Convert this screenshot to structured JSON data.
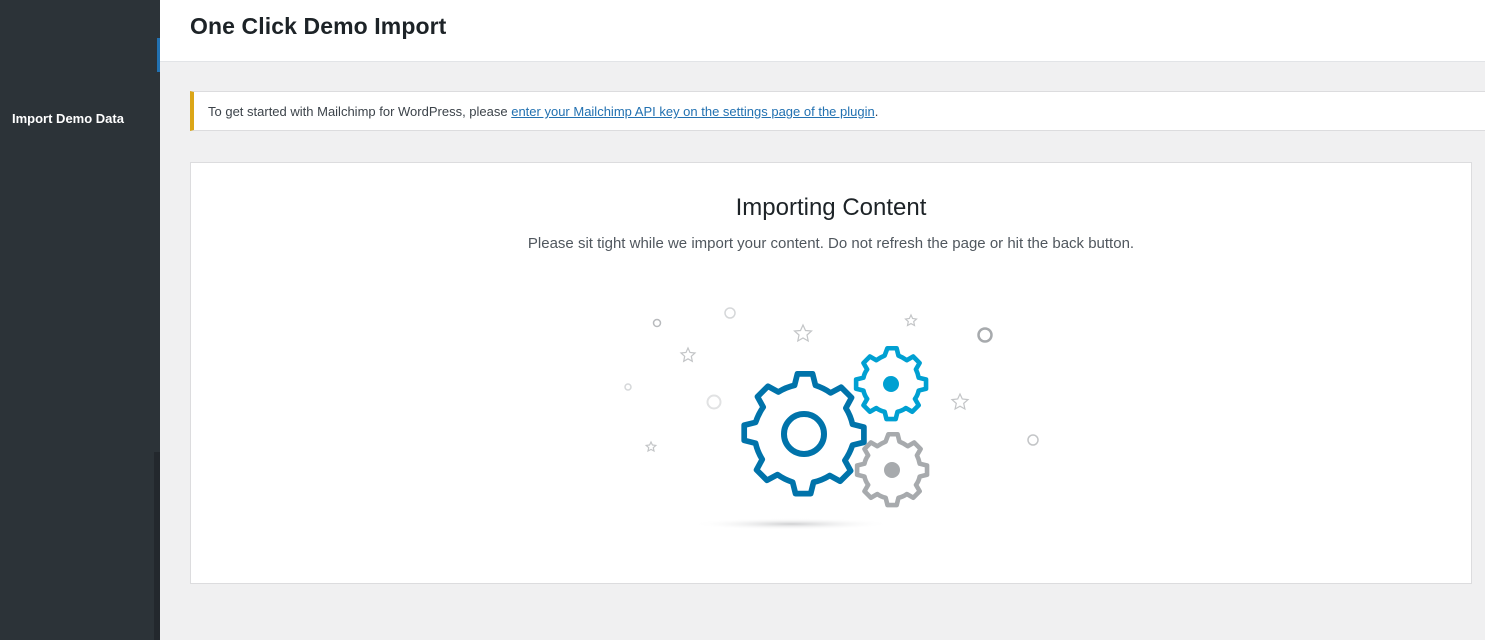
{
  "sidebar": {
    "active_item": "Import Demo Data"
  },
  "header": {
    "title": "One Click Demo Import"
  },
  "notice": {
    "text_before": "To get started with Mailchimp for WordPress, please ",
    "link_text": "enter your Mailchimp API key on the settings page of the plugin",
    "text_after": "."
  },
  "import_panel": {
    "title": "Importing Content",
    "subtitle": "Please sit tight while we import your content. Do not refresh the page or hit the back button."
  },
  "colors": {
    "sidebar_bg": "#2c3338",
    "accent_blue": "#0073aa",
    "light_blue": "#00a0d2",
    "gear_gray": "#a7aaad",
    "notice_warning": "#dba617"
  }
}
